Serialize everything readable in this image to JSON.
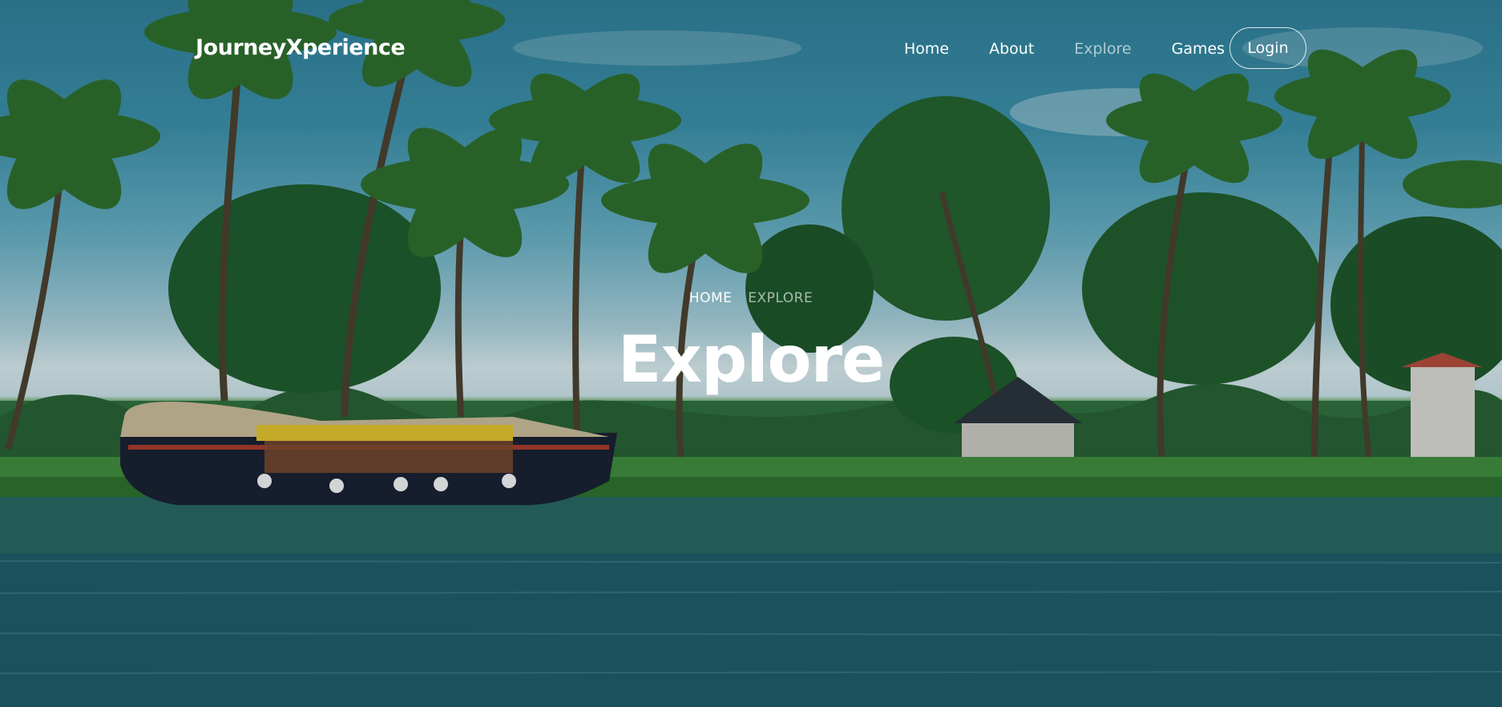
{
  "brand": {
    "name": "JourneyXperience"
  },
  "nav": {
    "items": [
      {
        "label": "Home",
        "active": false
      },
      {
        "label": "About",
        "active": false
      },
      {
        "label": "Explore",
        "active": true
      },
      {
        "label": "Games",
        "active": false
      }
    ],
    "login_label": "Login"
  },
  "hero": {
    "breadcrumb": {
      "home": "HOME",
      "current": "EXPLORE"
    },
    "title": "Explore",
    "image": "kerala-backwaters-houseboat-photo"
  },
  "colors": {
    "text": "#ffffff",
    "muted_text": "#c8d6d8",
    "sky": "#3c8ea6",
    "water": "#1e5a66",
    "foliage": "#2f7a3a"
  }
}
